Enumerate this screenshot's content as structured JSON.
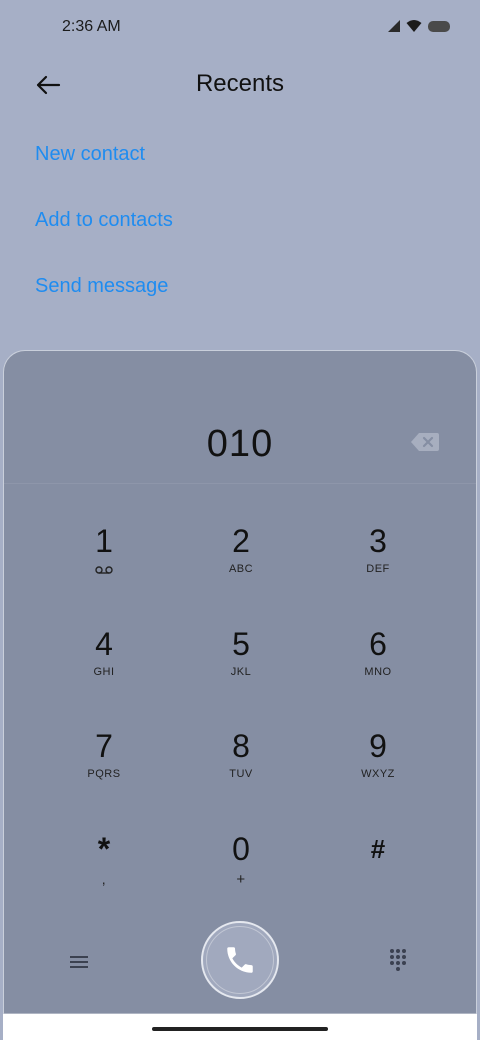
{
  "status_bar": {
    "time": "2:36 AM"
  },
  "header": {
    "title": "Recents"
  },
  "actions": [
    {
      "label": "New contact"
    },
    {
      "label": "Add to contacts"
    },
    {
      "label": "Send message"
    }
  ],
  "dialer": {
    "number": "010",
    "keys": [
      {
        "digit": "1",
        "letters": ""
      },
      {
        "digit": "2",
        "letters": "ABC"
      },
      {
        "digit": "3",
        "letters": "DEF"
      },
      {
        "digit": "4",
        "letters": "GHI"
      },
      {
        "digit": "5",
        "letters": "JKL"
      },
      {
        "digit": "6",
        "letters": "MNO"
      },
      {
        "digit": "7",
        "letters": "PQRS"
      },
      {
        "digit": "8",
        "letters": "TUV"
      },
      {
        "digit": "9",
        "letters": "WXYZ"
      },
      {
        "digit": "*",
        "letters": ","
      },
      {
        "digit": "0",
        "letters": "+"
      },
      {
        "digit": "#",
        "letters": ""
      }
    ]
  },
  "colors": {
    "link": "#1f8cf0",
    "background": "#a6afc6",
    "dialpad": "#858ea3"
  },
  "icons": [
    "back-arrow-icon",
    "backspace-icon",
    "voicemail-icon",
    "menu-icon",
    "phone-icon",
    "keypad-icon",
    "signal-icon",
    "wifi-icon",
    "battery-icon"
  ]
}
